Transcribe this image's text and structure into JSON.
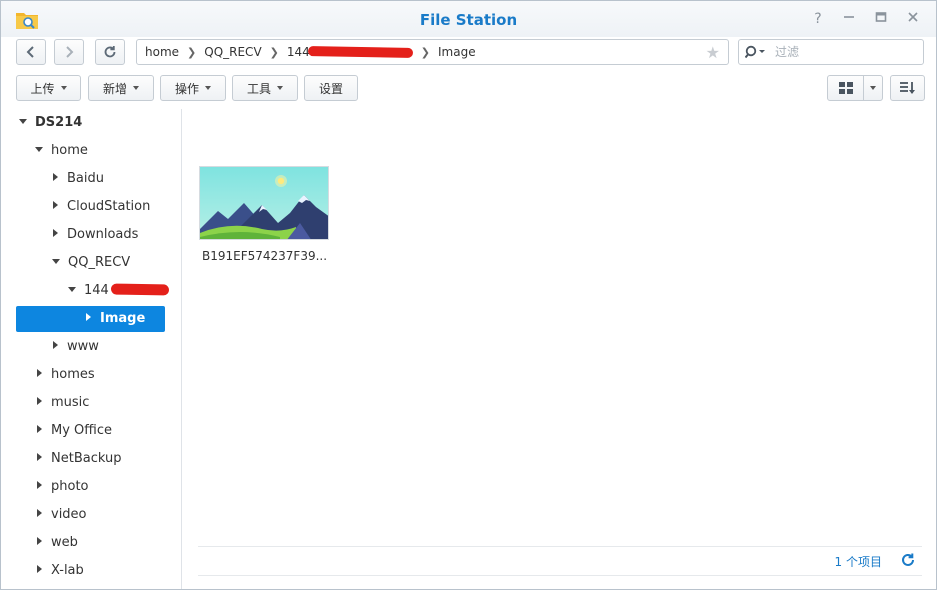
{
  "window": {
    "title": "File Station"
  },
  "toolbar": {
    "breadcrumb": [
      "home",
      "QQ_RECV",
      "144",
      "Image"
    ],
    "search_placeholder": "过滤",
    "actions": [
      "上传",
      "新增",
      "操作",
      "工具",
      "设置"
    ]
  },
  "sidebar": {
    "root": "DS214",
    "items": [
      {
        "label": "home"
      },
      {
        "label": "Baidu"
      },
      {
        "label": "CloudStation"
      },
      {
        "label": "Downloads"
      },
      {
        "label": "QQ_RECV"
      },
      {
        "label": "144"
      },
      {
        "label": "Image"
      },
      {
        "label": "www"
      },
      {
        "label": "homes"
      },
      {
        "label": "music"
      },
      {
        "label": "My Office"
      },
      {
        "label": "NetBackup"
      },
      {
        "label": "photo"
      },
      {
        "label": "video"
      },
      {
        "label": "web"
      },
      {
        "label": "X-lab"
      }
    ]
  },
  "main": {
    "files": [
      {
        "name": "B191EF574237F39..."
      }
    ],
    "item_count": "1 个项目"
  },
  "colors": {
    "accent": "#1a7bc8",
    "selected": "#0d86e0",
    "redaction": "#e4201a"
  }
}
